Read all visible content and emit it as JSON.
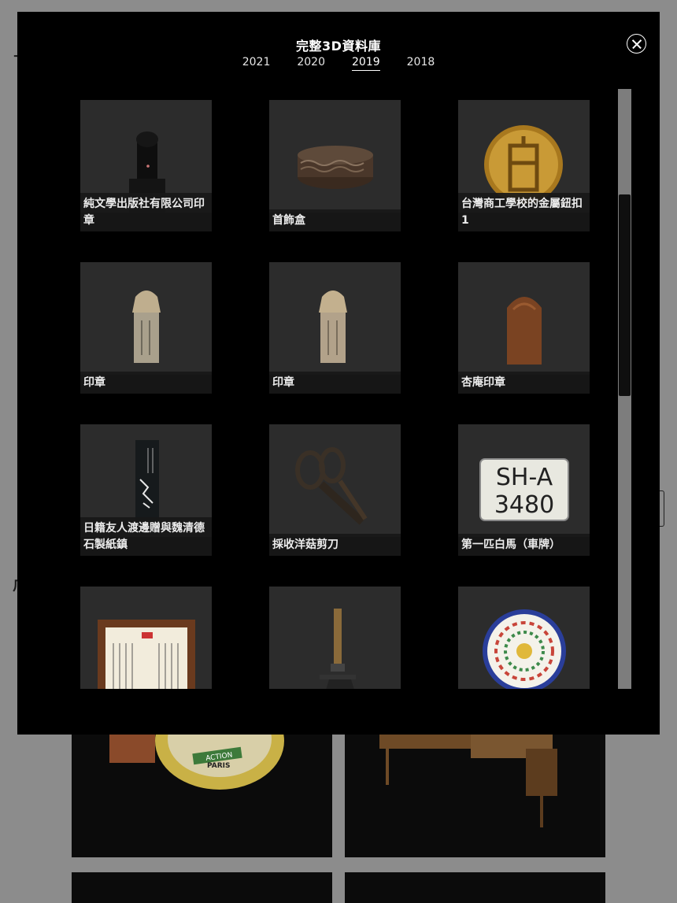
{
  "modal": {
    "title": "完整3D資料庫",
    "years": [
      "2021",
      "2020",
      "2019",
      "2018"
    ],
    "active_year": "2019"
  },
  "items": [
    {
      "label": "純文學出版社有限公司印章",
      "icon": "seal-icon"
    },
    {
      "label": "首飾盒",
      "icon": "jewelry-box-icon"
    },
    {
      "label": "台灣商工學校的金屬鈕扣1",
      "icon": "metal-button-icon"
    },
    {
      "label": "印章",
      "icon": "stone-seal-icon"
    },
    {
      "label": "印章",
      "icon": "stone-seal-icon"
    },
    {
      "label": "杏庵印章",
      "icon": "wood-seal-icon"
    },
    {
      "label": "日籍友人渡邊贈與魏清德石製紙鎮",
      "icon": "paperweight-icon"
    },
    {
      "label": "採收洋菇剪刀",
      "icon": "scissors-icon"
    },
    {
      "label": "第一匹白馬（車牌）",
      "icon": "license-plate-icon"
    },
    {
      "label": "",
      "icon": "framed-certificate-icon"
    },
    {
      "label": "",
      "icon": "microscope-icon"
    },
    {
      "label": "",
      "icon": "decorative-plate-icon"
    }
  ],
  "plate_text": [
    "SH-A",
    "3480"
  ],
  "background_page": {
    "tin_text": [
      "ACTION",
      "PARIS"
    ],
    "letters": [
      "ㄗ",
      "ㄏ"
    ]
  },
  "colors": {
    "modal_bg": "#000000",
    "thumb_bg": "#2c2c2c",
    "overlay": "#8c8c8c"
  }
}
